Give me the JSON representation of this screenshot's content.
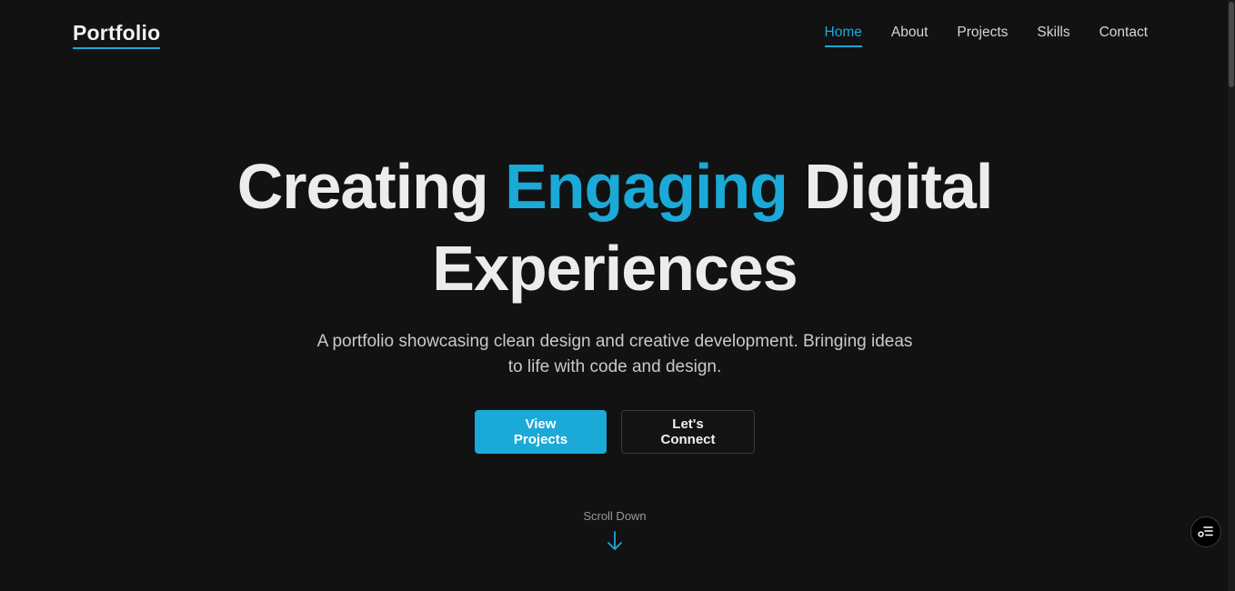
{
  "header": {
    "logo": "Portfolio",
    "nav": [
      {
        "label": "Home",
        "active": true
      },
      {
        "label": "About",
        "active": false
      },
      {
        "label": "Projects",
        "active": false
      },
      {
        "label": "Skills",
        "active": false
      },
      {
        "label": "Contact",
        "active": false
      }
    ]
  },
  "hero": {
    "headline_part1": "Creating ",
    "headline_accent": "Engaging",
    "headline_part2": " Digital",
    "headline_line2": "Experiences",
    "subtitle": "A portfolio showcasing clean design and creative development. Bringing ideas to life with code and design.",
    "primary_button": "View Projects",
    "secondary_button": "Let's Connect",
    "scroll_label": "Scroll Down"
  },
  "icons": {
    "scroll_arrow": "arrow-down-icon",
    "fab": "list-toggle-icon"
  },
  "colors": {
    "background": "#121212",
    "accent": "#1ba9d8",
    "text": "#ececec",
    "muted": "#c9c9c9"
  }
}
